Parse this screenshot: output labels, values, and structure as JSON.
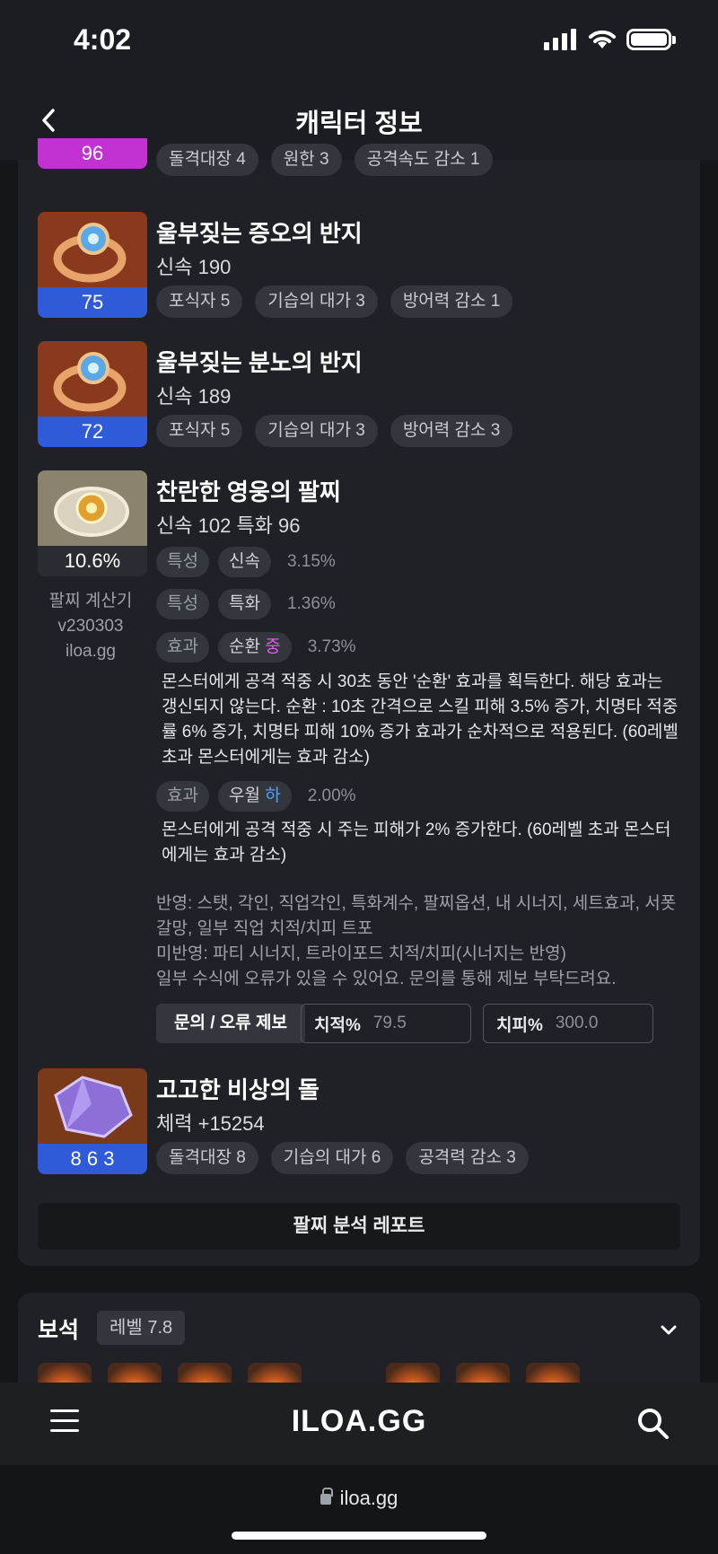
{
  "status": {
    "time": "4:02"
  },
  "header": {
    "title": "캐릭터 정보",
    "back_icon": "chevron-left-icon"
  },
  "items": [
    {
      "level": "96",
      "chips": [
        "돌격대장 4",
        "원한 3",
        "공격속도 감소 1"
      ],
      "color": "#c232d3"
    },
    {
      "name": "울부짖는 증오의 반지",
      "stat": "신속 190",
      "level": "75",
      "chips": [
        "포식자 5",
        "기습의 대가 3",
        "방어력 감소 1"
      ]
    },
    {
      "name": "울부짖는 분노의 반지",
      "stat": "신속 189",
      "level": "72",
      "chips": [
        "포식자 5",
        "기습의 대가 3",
        "방어력 감소 3"
      ]
    },
    {
      "name": "찬란한 영웅의 팔찌",
      "stat": "신속 102  특화 96",
      "level": "10.6%",
      "calc_label": [
        "팔찌 계산기",
        "v230303",
        "iloa.gg"
      ],
      "options": [
        {
          "tag": "특성",
          "name": "신속",
          "grade": "",
          "pct": "3.15%"
        },
        {
          "tag": "특성",
          "name": "특화",
          "grade": "",
          "pct": "1.36%"
        },
        {
          "tag": "효과",
          "name": "순환 ",
          "grade": "중",
          "pct": "3.73%"
        },
        {
          "tag": "효과",
          "name": "우월 ",
          "grade": "하",
          "pct": "2.00%"
        }
      ],
      "desc1": "몬스터에게 공격 적중 시 30초 동안 '순환' 효과를 획득한다. 해당 효과는 갱신되지 않는다. 순환 : 10초 간격으로 스킬 피해 3.5% 증가, 치명타 적중률 6% 증가, 치명타 피해 10% 증가 효과가 순차적으로 적용된다. (60레벨 초과 몬스터에게는 효과 감소)",
      "desc2": "몬스터에게 공격 적중 시 주는 피해가 2% 증가한다. (60레벨 초과 몬스터에게는 효과 감소)",
      "notes": [
        "반영: 스탯, 각인, 직업각인, 특화계수, 팔찌옵션, 내 시너지, 세트효과, 서폿 갈망, 일부 직업 치적/치피 트포",
        "미반영: 파티 시너지, 트라이포드 치적/치피(시너지는 반영)",
        "일부 수식에 오류가 있을 수 있어요. 문의를 통해 제보 부탁드려요."
      ],
      "report_button": "문의 / 오류 제보",
      "crit_rate": {
        "label": "치적%",
        "value": "79.5"
      },
      "crit_dmg": {
        "label": "치피%",
        "value": "300.0"
      }
    },
    {
      "name": "고고한 비상의 돌",
      "stat": "체력 +15254",
      "level": "8 6 3",
      "chips": [
        "돌격대장 8",
        "기습의 대가 6",
        "공격력 감소 3"
      ]
    }
  ],
  "analysis_button": "팔찌 분석 레포트",
  "gems": {
    "title": "보석",
    "level": "레벨 7.8"
  },
  "bottom_nav": {
    "logo": "ILOA.GG"
  },
  "url": "iloa.gg"
}
